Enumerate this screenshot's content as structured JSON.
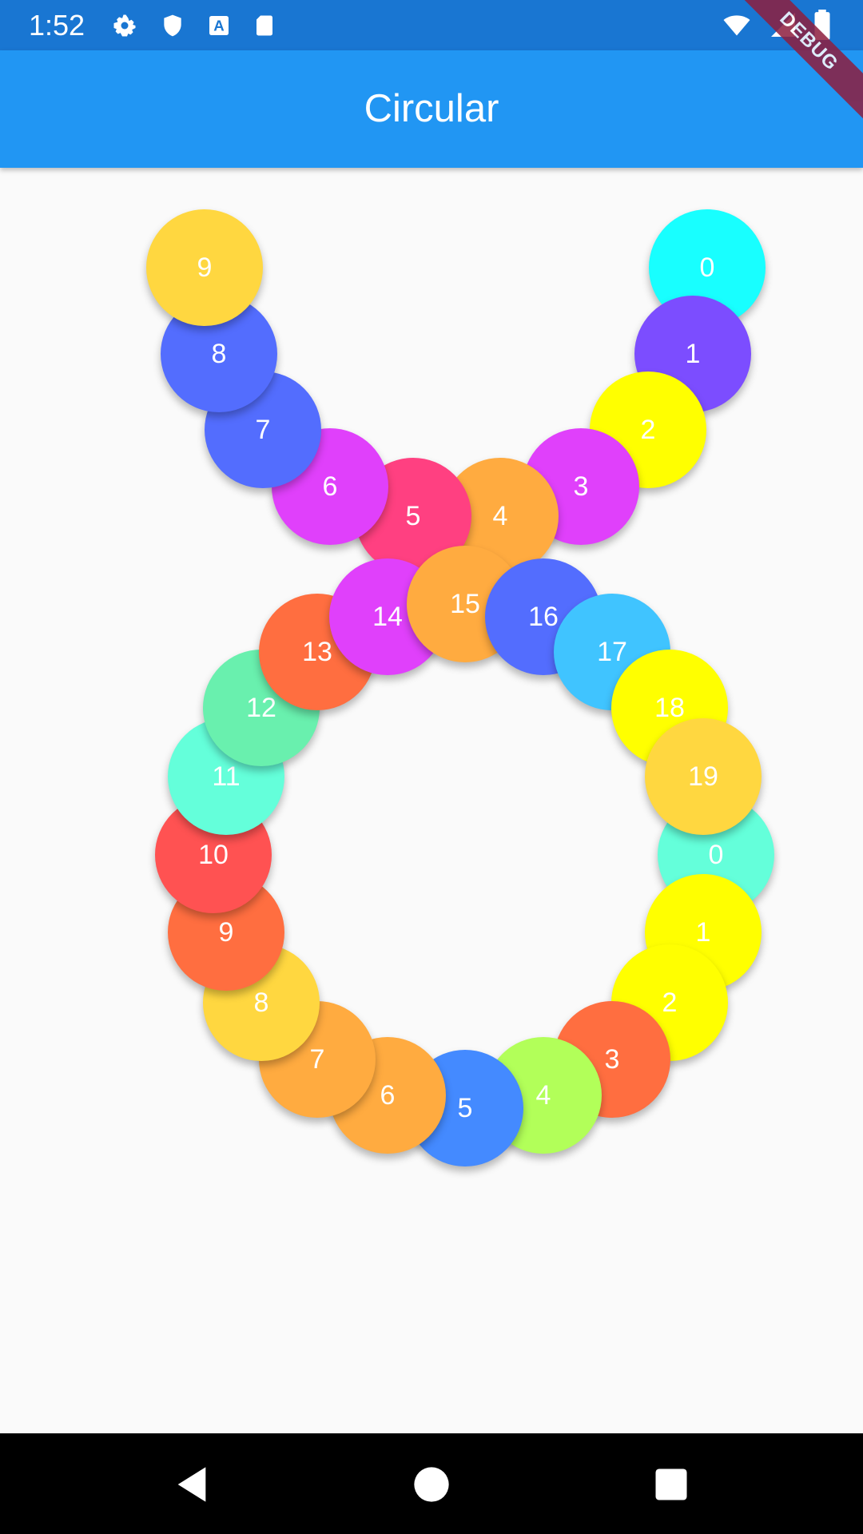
{
  "status_bar": {
    "time": "1:52",
    "icons": [
      "gear-icon",
      "shield-icon",
      "a-icon",
      "sd-card-icon"
    ],
    "right_icons": [
      "wifi-icon",
      "signal-icon",
      "battery-icon"
    ]
  },
  "app_bar": {
    "title": "Circular"
  },
  "debug_banner": {
    "label": "DEBUG"
  },
  "arc_bubbles": [
    {
      "label": "0",
      "color": "#18ffff"
    },
    {
      "label": "1",
      "color": "#7c4dff"
    },
    {
      "label": "2",
      "color": "#ffff00"
    },
    {
      "label": "3",
      "color": "#e040fb"
    },
    {
      "label": "4",
      "color": "#ffab40"
    },
    {
      "label": "5",
      "color": "#ff4081"
    },
    {
      "label": "6",
      "color": "#e040fb"
    },
    {
      "label": "7",
      "color": "#536dfe"
    },
    {
      "label": "8",
      "color": "#536dfe"
    },
    {
      "label": "9",
      "color": "#ffd740"
    }
  ],
  "ring_bubbles": [
    {
      "label": "0",
      "color": "#64ffda"
    },
    {
      "label": "1",
      "color": "#ffff00"
    },
    {
      "label": "2",
      "color": "#ffff00"
    },
    {
      "label": "3",
      "color": "#ff6e40"
    },
    {
      "label": "4",
      "color": "#b2ff59"
    },
    {
      "label": "5",
      "color": "#448aff"
    },
    {
      "label": "6",
      "color": "#ffab40"
    },
    {
      "label": "7",
      "color": "#ffab40"
    },
    {
      "label": "8",
      "color": "#ffd740"
    },
    {
      "label": "9",
      "color": "#ff6e40"
    },
    {
      "label": "10",
      "color": "#ff5252"
    },
    {
      "label": "11",
      "color": "#64ffda"
    },
    {
      "label": "12",
      "color": "#69f0ae"
    },
    {
      "label": "13",
      "color": "#ff6e40"
    },
    {
      "label": "14",
      "color": "#e040fb"
    },
    {
      "label": "15",
      "color": "#ffab40"
    },
    {
      "label": "16",
      "color": "#536dfe"
    },
    {
      "label": "17",
      "color": "#40c4ff"
    },
    {
      "label": "18",
      "color": "#ffff00"
    },
    {
      "label": "19",
      "color": "#ffd740"
    }
  ],
  "nav_bar": {
    "buttons": [
      "back-icon",
      "home-icon",
      "recents-icon"
    ]
  }
}
